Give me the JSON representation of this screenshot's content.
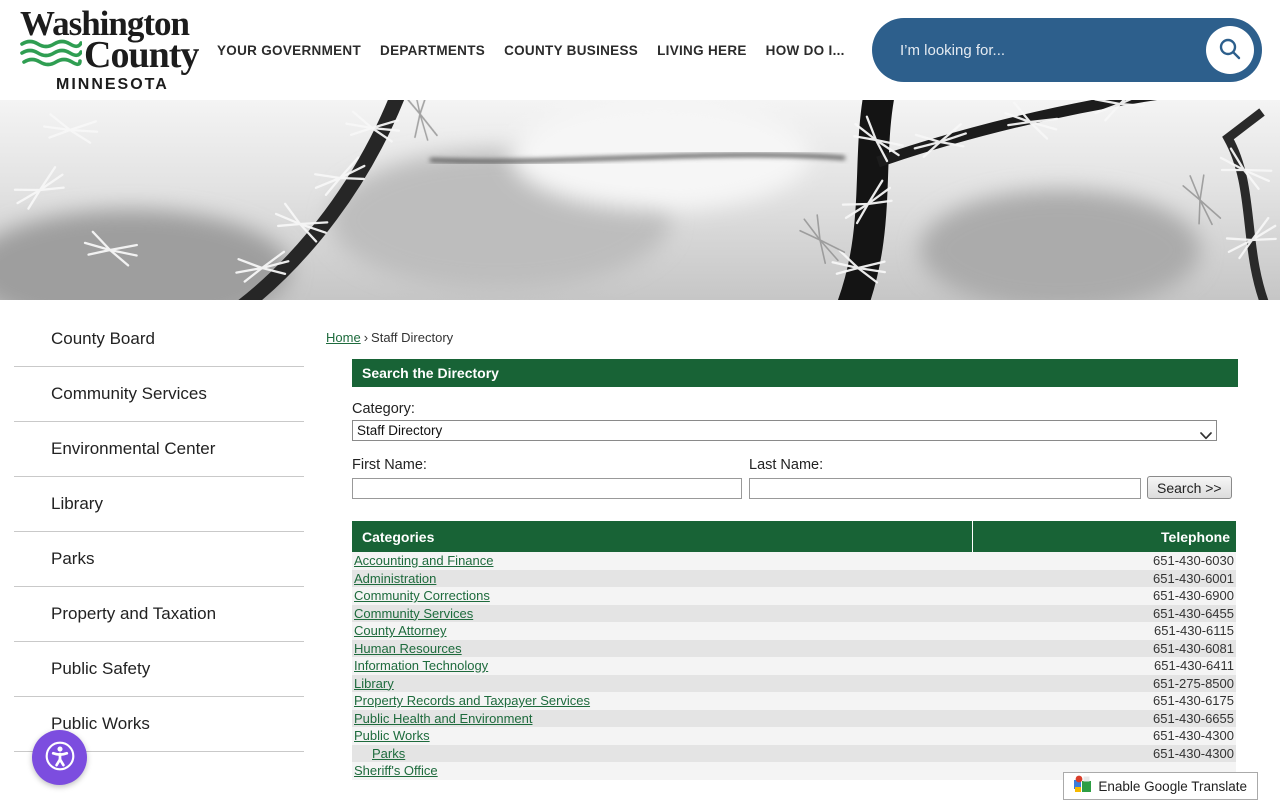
{
  "header": {
    "logo": {
      "name_line1": "Washington",
      "name_line2": "County",
      "state": "MINNESOTA"
    },
    "nav": [
      "YOUR GOVERNMENT",
      "DEPARTMENTS",
      "COUNTY BUSINESS",
      "LIVING HERE",
      "HOW DO I..."
    ],
    "search_placeholder": "I’m looking for..."
  },
  "sidebar": {
    "items": [
      "County Board",
      "Community Services",
      "Environmental Center",
      "Library",
      "Parks",
      "Property and Taxation",
      "Public Safety",
      "Public Works"
    ]
  },
  "breadcrumb": {
    "home": "Home",
    "separator": "›",
    "current": "Staff Directory"
  },
  "search_panel": {
    "title": "Search the Directory",
    "category_label": "Category:",
    "category_value": "Staff Directory",
    "first_name_label": "First Name:",
    "first_name_value": "",
    "last_name_label": "Last Name:",
    "last_name_value": "",
    "search_button_label": "Search >>"
  },
  "table": {
    "headers": {
      "categories": "Categories",
      "telephone": "Telephone"
    },
    "rows": [
      {
        "category": "Accounting and Finance",
        "telephone": "651-430-6030"
      },
      {
        "category": "Administration",
        "telephone": "651-430-6001"
      },
      {
        "category": "Community Corrections",
        "telephone": "651-430-6900"
      },
      {
        "category": "Community Services",
        "telephone": "651-430-6455"
      },
      {
        "category": "County Attorney",
        "telephone": "651-430-6115"
      },
      {
        "category": "Human Resources",
        "telephone": "651-430-6081"
      },
      {
        "category": "Information Technology",
        "telephone": "651-430-6411"
      },
      {
        "category": "Library",
        "telephone": "651-275-8500"
      },
      {
        "category": "Property Records and Taxpayer Services",
        "telephone": "651-430-6175"
      },
      {
        "category": "Public Health and Environment",
        "telephone": "651-430-6655"
      },
      {
        "category": "Public Works",
        "telephone": "651-430-4300"
      },
      {
        "category": "Parks",
        "telephone": "651-430-4300"
      },
      {
        "category": "Sheriff's Office",
        "telephone": ""
      }
    ]
  },
  "widgets": {
    "translate_label": "Enable Google Translate"
  },
  "colors": {
    "brand_green": "#186336",
    "link_green": "#1e6b3d",
    "search_blue": "#2d5f8c",
    "accessibility_purple": "#7c4ddf"
  }
}
